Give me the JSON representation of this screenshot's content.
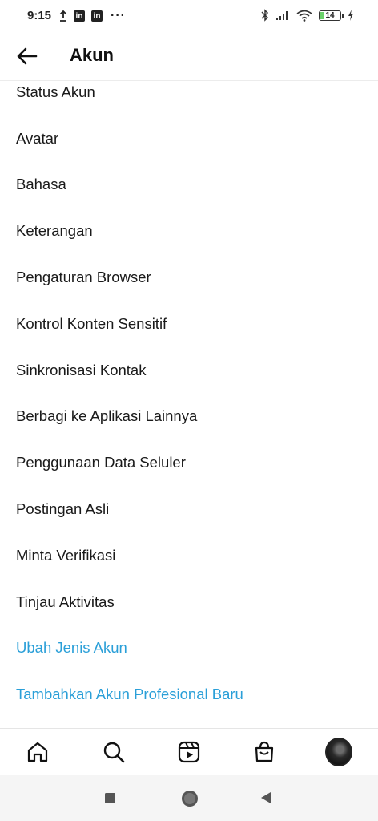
{
  "status_bar": {
    "time": "9:15",
    "left_icons": [
      "upload-icon",
      "linkedin-icon",
      "linkedin-icon"
    ],
    "more": "···",
    "battery": "14",
    "right_icons": [
      "bluetooth-icon",
      "signal-icon",
      "wifi-icon",
      "battery-icon",
      "charging-icon"
    ]
  },
  "header": {
    "title": "Akun"
  },
  "menu": {
    "items": [
      "Status Akun",
      "Avatar",
      "Bahasa",
      "Keterangan",
      "Pengaturan Browser",
      "Kontrol Konten Sensitif",
      "Sinkronisasi Kontak",
      "Berbagi ke Aplikasi Lainnya",
      "Penggunaan Data Seluler",
      "Postingan Asli",
      "Minta Verifikasi",
      "Tinjau Aktivitas"
    ],
    "links": [
      "Ubah Jenis Akun",
      "Tambahkan Akun Profesional Baru"
    ],
    "link_color": "#2a9fd8"
  },
  "bottom_nav": [
    "home-icon",
    "search-icon",
    "reels-icon",
    "shop-icon",
    "profile-avatar"
  ],
  "system_nav": [
    "recents-icon",
    "home-circle-icon",
    "back-triangle-icon"
  ]
}
